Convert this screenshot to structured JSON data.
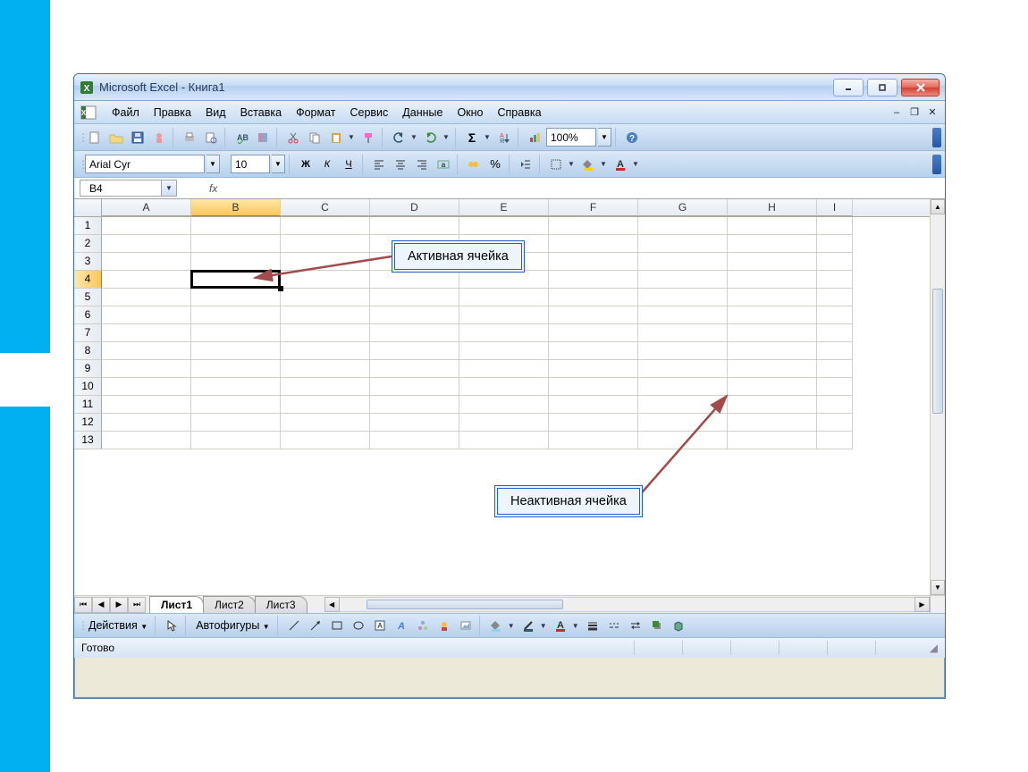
{
  "window": {
    "title": "Microsoft Excel - Книга1"
  },
  "menu": {
    "items": [
      "Файл",
      "Правка",
      "Вид",
      "Вставка",
      "Формат",
      "Сервис",
      "Данные",
      "Окно",
      "Справка"
    ]
  },
  "toolbar_std": {
    "zoom": "100%"
  },
  "toolbar_fmt": {
    "font": "Arial Cyr",
    "size": "10",
    "bold": "Ж",
    "italic": "К",
    "underline": "Ч",
    "currency_icon": "%",
    "pct_icon": "%"
  },
  "formulabar": {
    "name_box": "B4",
    "fx": "fx",
    "formula": ""
  },
  "grid": {
    "columns": [
      "A",
      "B",
      "C",
      "D",
      "E",
      "F",
      "G",
      "H",
      "I"
    ],
    "rows": [
      "1",
      "2",
      "3",
      "4",
      "5",
      "6",
      "7",
      "8",
      "9",
      "10",
      "11",
      "12",
      "13"
    ],
    "active_col": "B",
    "active_row": "4"
  },
  "sheets": {
    "tabs": [
      "Лист1",
      "Лист2",
      "Лист3"
    ],
    "active": 0
  },
  "draw": {
    "actions": "Действия",
    "autoshapes": "Автофигуры"
  },
  "status": {
    "text": "Готово"
  },
  "annotations": {
    "active_cell": "Активная ячейка",
    "inactive_cell": "Неактивная ячейка"
  }
}
